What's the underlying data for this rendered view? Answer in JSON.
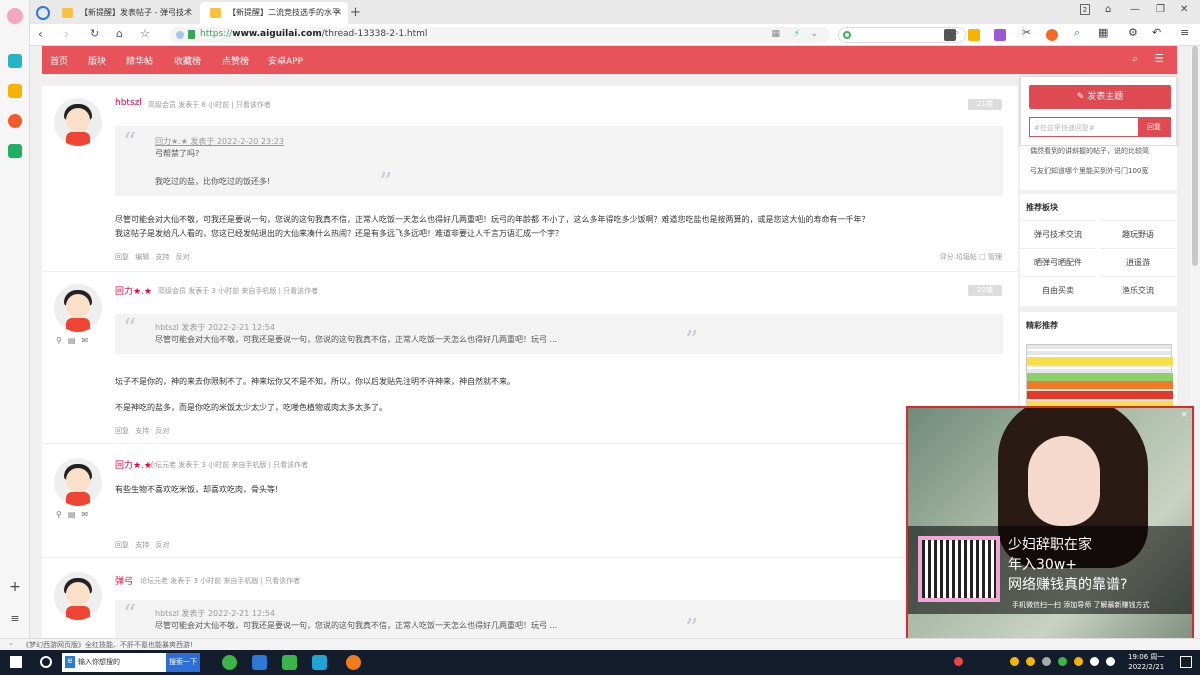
{
  "browser": {
    "tabs": [
      {
        "label": "【新提醒】发表帖子 - 弹弓技术"
      },
      {
        "label": "【新提醒】二流竞技选手的水平"
      }
    ],
    "url_scheme": "https://",
    "url_domain": "www.aiguilai.com",
    "url_path": "/thread-13338-2-1.html",
    "new_tab": "+"
  },
  "nav": {
    "items": [
      "首页",
      "版块",
      "精华帖",
      "收藏榜",
      "点赞榜",
      "安卓APP"
    ]
  },
  "posts": [
    {
      "username": "hbtszl",
      "meta": "高级会员   发表于 6 小时前  |  只看该作者",
      "floor": "21楼",
      "quote_header": "回力★.★ 发表于 2022-2-20 23:23",
      "quote_lines": [
        "弓帮禁了吗?",
        "我吃过的盐，比你吃过的饭还多!"
      ],
      "text_lines": [
        "尽管可能会对大仙不敬，可我还是要说一句，您说的这句我真不信，正常人吃饭一天怎么也得好几两重吧！玩弓的年龄都 不小了，这么多年得吃多少饭啊？难道您吃盐也是按两算的，或是您这大仙的寿命有一千年？",
        "我这帖子是发给凡人看的，您这已经发帖退出的大仙来凑什么热闹？还是有多远飞多远吧！难道非要让人千言万语汇成一个字？"
      ],
      "actions": "回复  编辑  支持  反对",
      "right_actions": "评分  垃圾帖  □ 管理"
    },
    {
      "username": "回力★.★",
      "meta": "高级会员   发表于 3 小时前 来自手机版  |  只看该作者",
      "floor": "22楼",
      "quote_header": "hbtszl 发表于 2022-2-21 12:54",
      "quote_lines": [
        "尽管可能会对大仙不敬，可我还是要说一句，您说的这句我真不信，正常人吃饭一天怎么也得好几两重吧！玩弓 ..."
      ],
      "text_lines": [
        "坛子不是你的，神的来去你限制不了。神来坛你又不是不知，所以，你以后发贴先注明不许神来，神自然就不来。",
        "不是神吃的盐多，而是你吃的米饭太少太少了，吃喽色植物或肉太多太多了。"
      ],
      "actions": "回复  支持  反对"
    },
    {
      "username": "回力★.★",
      "meta": "论坛元老   发表于 3 小时前 来自手机版  |  只看该作者",
      "text_lines": [
        "有些生物不喜欢吃米饭，却喜欢吃肉，骨头等!"
      ],
      "actions": "回复  支持  反对"
    },
    {
      "username": "弹弓",
      "meta": "论坛元老   发表于 3 小时前 来自手机版  |  只看该作者",
      "quote_header": "hbtszl 发表于 2022-2-21 12:54",
      "quote_lines": [
        "尽管可能会对大仙不敬，可我还是要说一句，您说的这句我真不信，正常人吃饭一天怎么也得好几两重吧！玩弓 ..."
      ]
    }
  ],
  "sidebar": {
    "new_post": "发表主题",
    "reply_placeholder": "#在这里快速回复#",
    "reply_button": "回复",
    "snippet_lines": [
      "偶然看到的讲斜握的帖子，说的比较简",
      "弓友们知道哪个里能买到外弓门100宽"
    ],
    "forums_title": "推荐板块",
    "forums": [
      "弹弓技术交流",
      "趣玩野语",
      "晒弹弓晒配件",
      "逍遥游",
      "自由买卖",
      "渔乐交流"
    ],
    "featured_title": "精彩推荐"
  },
  "ad": {
    "line1": "少妇辞职在家",
    "line2": "年入30w+",
    "line3": "网络赚钱真的靠谱?",
    "line4": "手机微信扫一扫  添加导师  了解最新赚钱方式",
    "close": "×"
  },
  "status": {
    "text": "《梦幻西游网页版》全红技能、不肝不氪也能暴爽西游!"
  },
  "taskbar": {
    "search_text": "输入你想搜的",
    "search_button": "搜索一下",
    "time": "19:06 周一",
    "date": "2022/2/21"
  },
  "colors": {
    "brand_red": "#e8525a",
    "username_red": "#e04"
  }
}
